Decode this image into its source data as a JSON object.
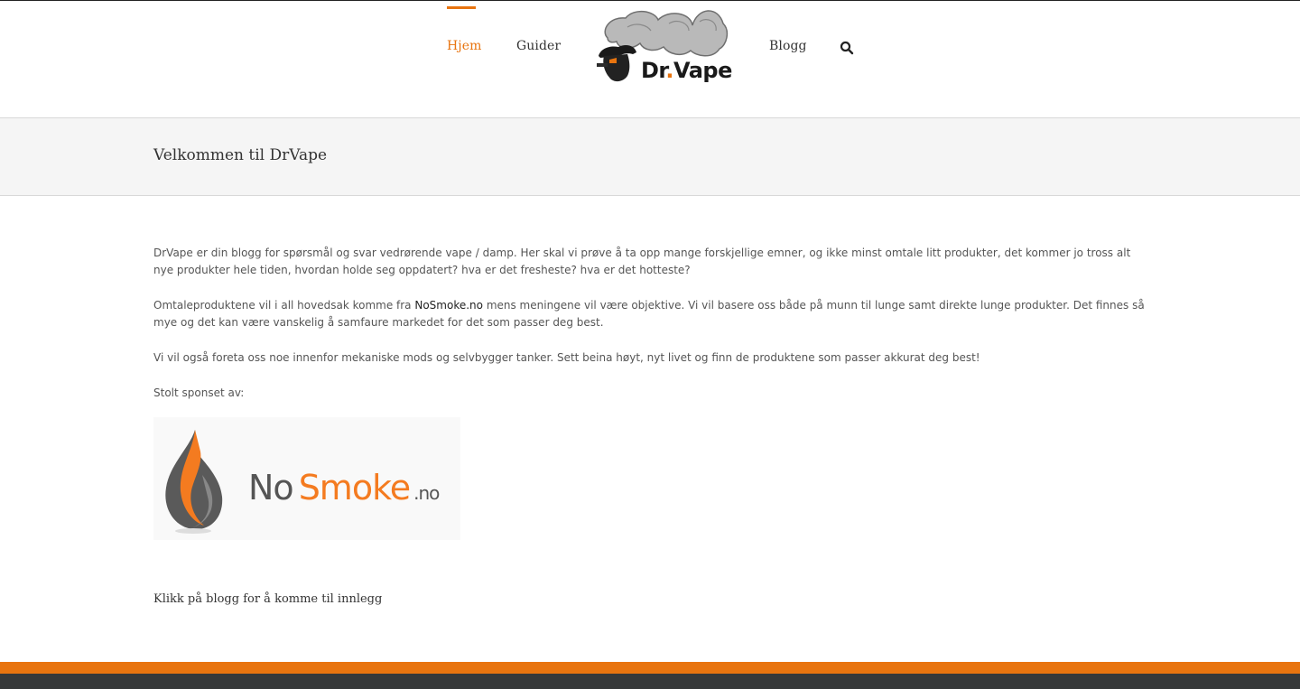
{
  "header": {
    "nav": [
      {
        "label": "Hjem",
        "active": true
      },
      {
        "label": "Guider",
        "active": false
      },
      {
        "label": "Blogg",
        "active": false
      }
    ],
    "logo": {
      "text_main": "Dr",
      "text_dot": ".",
      "text_end": "Vape"
    },
    "search_icon": "search-icon",
    "accent_color": "#e8740f"
  },
  "titlebar": {
    "title": "Velkommen til DrVape"
  },
  "content": {
    "p1": "DrVape er din blogg for spørsmål og svar vedrørende vape / damp. Her skal vi prøve å ta opp mange forskjellige emner, og ikke minst omtale litt produkter, det kommer jo tross alt nye produkter hele tiden, hvordan holde seg oppdatert? hva er det fresheste? hva er det hotteste?",
    "p2_before": "Omtaleproduktene vil i all hovedsak komme fra ",
    "p2_link": "NoSmoke.no",
    "p2_after": " mens meningene vil være objektive. Vi vil basere oss både på munn til lunge samt direkte lunge produkter. Det finnes så mye og det kan være vanskelig å samfaure markedet for det som passer deg best.",
    "p3": "Vi vil også foreta oss noe innenfor mekaniske mods og selvbygger tanker. Sett beina høyt, nyt livet og finn de produktene som passer akkurat deg best!",
    "p4": "Stolt sponset av:",
    "sponsor": {
      "no": "No",
      "smoke": "Smoke",
      "tld": ".no"
    },
    "footer_note": "Klikk på blogg for å komme til innlegg"
  },
  "footer": {
    "accent_color": "#e8740f",
    "dark_color": "#363839"
  }
}
